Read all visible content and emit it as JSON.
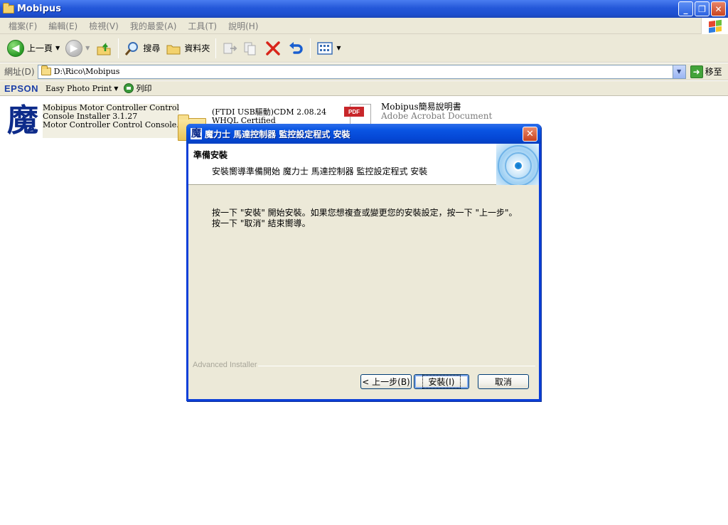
{
  "window": {
    "title": "Mobipus",
    "buttons": {
      "minimize": "_",
      "maximize": "❐",
      "close": "✕"
    }
  },
  "menu": [
    "檔案(F)",
    "編輯(E)",
    "檢視(V)",
    "我的最愛(A)",
    "工具(T)",
    "說明(H)"
  ],
  "toolbar": {
    "back_label": "上一頁",
    "search_label": "搜尋",
    "folders_label": "資料夾"
  },
  "address": {
    "label": "網址(D)",
    "value": "D:\\Rico\\Mobipus",
    "go_label": "移至"
  },
  "epson": {
    "logo": "EPSON",
    "easy_photo_print": "Easy Photo Print",
    "print_label": "列印"
  },
  "files": [
    {
      "icon_glyph": "魔",
      "lines": [
        "Mobipus Motor Controller Control",
        "Console Installer 3.1.27",
        "Motor Controller Control Console."
      ]
    },
    {
      "lines": [
        "(FTDI USB驅動)CDM 2.08.24",
        "WHQL Certified"
      ]
    },
    {
      "icon_tag": "PDF",
      "name": "Mobipus簡易說明書",
      "subtitle": "Adobe Acrobat Document"
    }
  ],
  "dialog": {
    "title_glyph": "魔",
    "title": "魔力士 馬達控制器 監控設定程式 安裝",
    "close_glyph": "✕",
    "header_title": "準備安裝",
    "header_subtitle": "安裝嚮導準備開始 魔力士 馬達控制器 監控設定程式 安裝",
    "body_lines": [
      "按一下 \"安裝\" 開始安裝。如果您想複查或變更您的安裝設定，按一下 \"上一步\"。",
      "按一下 \"取消\" 結束嚮導。"
    ],
    "brand": "Advanced Installer",
    "buttons": {
      "back": "< 上一步(B)",
      "install": "安裝(I)",
      "cancel": "取消"
    }
  }
}
